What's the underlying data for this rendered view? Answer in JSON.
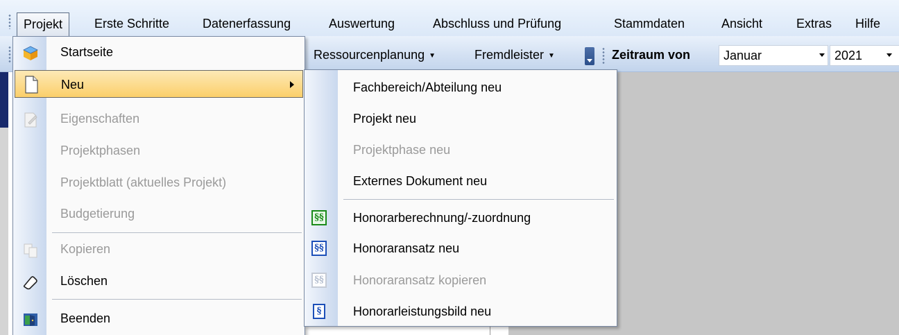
{
  "menubar": {
    "items": [
      "Projekt",
      "Erste Schritte",
      "Datenerfassung",
      "Auswertung",
      "Abschluss und Prüfung",
      "Stammdaten",
      "Ansicht",
      "Extras",
      "Hilfe"
    ]
  },
  "toolbar": {
    "ressourcenplanung": "Ressourcenplanung",
    "fremdleister": "Fremdleister",
    "zeitraum_label": "Zeitraum von",
    "month_value": "Januar",
    "year_value": "2021"
  },
  "projekt_menu": {
    "items": [
      {
        "label": "Startseite",
        "icon": "home-box-icon",
        "enabled": true
      },
      {
        "label": "Neu",
        "icon": "document-icon",
        "enabled": true,
        "highlighted": true,
        "submenu": true
      },
      {
        "label": "Eigenschaften",
        "icon": "edit-document-icon",
        "enabled": false
      },
      {
        "label": "Projektphasen",
        "enabled": false
      },
      {
        "label": "Projektblatt (aktuelles Projekt)",
        "enabled": false
      },
      {
        "label": "Budgetierung",
        "enabled": false
      },
      {
        "label": "Kopieren",
        "icon": "copy-icon",
        "enabled": false
      },
      {
        "label": "Löschen",
        "icon": "eraser-icon",
        "enabled": true
      },
      {
        "label": "Beenden",
        "icon": "exit-icon",
        "enabled": true
      }
    ]
  },
  "neu_submenu": {
    "items": [
      {
        "label": "Fachbereich/Abteilung neu",
        "enabled": true
      },
      {
        "label": "Projekt neu",
        "enabled": true
      },
      {
        "label": "Projektphase neu",
        "enabled": false
      },
      {
        "label": "Externes Dokument neu",
        "enabled": true
      },
      {
        "label": "Honorarberechnung/-zuordnung",
        "icon": "§§",
        "icon_color": "#1a8a1a",
        "enabled": true
      },
      {
        "label": "Honoraransatz neu",
        "icon": "§§",
        "icon_color": "#1c4fb8",
        "enabled": true
      },
      {
        "label": "Honoraransatz kopieren",
        "icon": "§§",
        "icon_color": "#a9b4c8",
        "enabled": false
      },
      {
        "label": "Honorarleistungsbild neu",
        "icon": "§",
        "icon_color": "#1c4fb8",
        "enabled": true
      }
    ]
  },
  "colors": {
    "highlight": "#fbcf6a",
    "menubar_bg": "#dbe8f8",
    "workspace": "#c6c6c6"
  }
}
